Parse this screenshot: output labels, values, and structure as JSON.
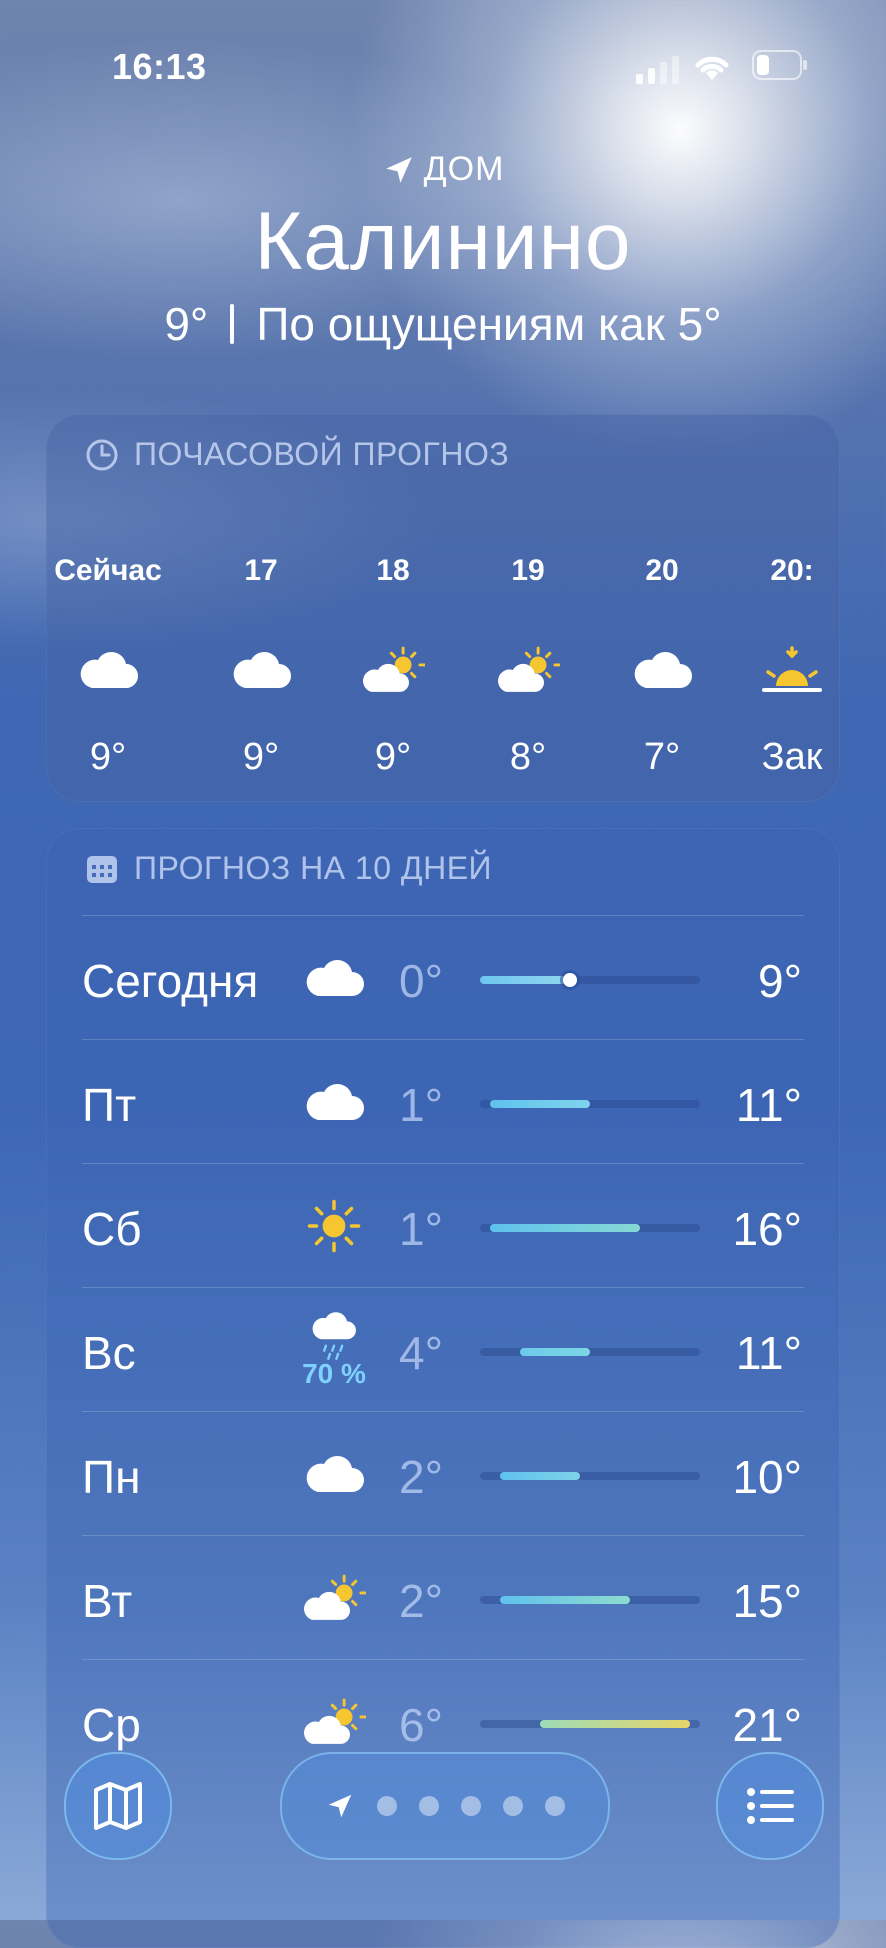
{
  "status": {
    "time": "16:13"
  },
  "header": {
    "location_label": "ДОМ",
    "city": "Калинино",
    "temp": "9°",
    "feels_like": "По ощущениям как 5°"
  },
  "hourly": {
    "title": "ПОЧАСОВОЙ ПРОГНОЗ",
    "items": [
      {
        "time": "Сейчас",
        "icon": "cloud-icon",
        "temp": "9°"
      },
      {
        "time": "17",
        "icon": "cloud-icon",
        "temp": "9°"
      },
      {
        "time": "18",
        "icon": "partly-sunny-icon",
        "temp": "9°"
      },
      {
        "time": "19",
        "icon": "partly-sunny-icon",
        "temp": "8°"
      },
      {
        "time": "20",
        "icon": "cloud-icon",
        "temp": "7°"
      },
      {
        "time": "20:",
        "icon": "sunset-icon",
        "temp": "Зак"
      }
    ]
  },
  "daily": {
    "title": "ПРОГНОЗ НА 10 ДНЕЙ",
    "scale": {
      "min": 0,
      "max": 22
    },
    "items": [
      {
        "day": "Сегодня",
        "icon": "cloud-icon",
        "low": "0°",
        "high": "9°",
        "lo": 0,
        "hi": 9,
        "current": 9,
        "color_a": "#6ec6f0",
        "color_b": "#8fd6ef"
      },
      {
        "day": "Пт",
        "icon": "cloud-icon",
        "low": "1°",
        "high": "11°",
        "lo": 1,
        "hi": 11,
        "color_a": "#5fc2ee",
        "color_b": "#7fd4ec"
      },
      {
        "day": "Сб",
        "icon": "sun-icon",
        "low": "1°",
        "high": "16°",
        "lo": 1,
        "hi": 16,
        "color_a": "#5fc2ee",
        "color_b": "#86d9d2"
      },
      {
        "day": "Вс",
        "icon": "rain-icon",
        "precip": "70 %",
        "low": "4°",
        "high": "11°",
        "lo": 4,
        "hi": 11,
        "color_a": "#6ccbea",
        "color_b": "#7dd6e6"
      },
      {
        "day": "Пн",
        "icon": "cloud-icon",
        "low": "2°",
        "high": "10°",
        "lo": 2,
        "hi": 10,
        "color_a": "#5fc2ee",
        "color_b": "#7fd2e8"
      },
      {
        "day": "Вт",
        "icon": "partly-sunny-icon",
        "low": "2°",
        "high": "15°",
        "lo": 2,
        "hi": 15,
        "color_a": "#5fc2ee",
        "color_b": "#8edccd"
      },
      {
        "day": "Ср",
        "icon": "partly-sunny-icon",
        "low": "6°",
        "high": "21°",
        "lo": 6,
        "hi": 21,
        "color_a": "#9edbb8",
        "color_b": "#e7d66a"
      }
    ]
  },
  "bottom": {
    "pages": 5
  }
}
